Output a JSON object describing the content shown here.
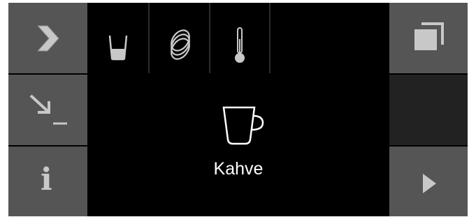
{
  "product": {
    "name": "Kahve",
    "icon": "coffee-cup-icon"
  },
  "left_buttons": [
    {
      "icon": "chevron-right-icon"
    },
    {
      "icon": "arrow-down-right-icon"
    },
    {
      "icon": "info-icon",
      "glyph": "i"
    }
  ],
  "tabs": [
    {
      "icon": "glass-icon"
    },
    {
      "icon": "coffee-beans-icon"
    },
    {
      "icon": "thermometer-icon"
    }
  ],
  "right_buttons": [
    {
      "icon": "copy-icon"
    },
    {
      "icon": "play-icon"
    }
  ],
  "colors": {
    "background": "#000000",
    "button": "#555555",
    "icon_light": "#c8c8c8",
    "text": "#ffffff"
  }
}
